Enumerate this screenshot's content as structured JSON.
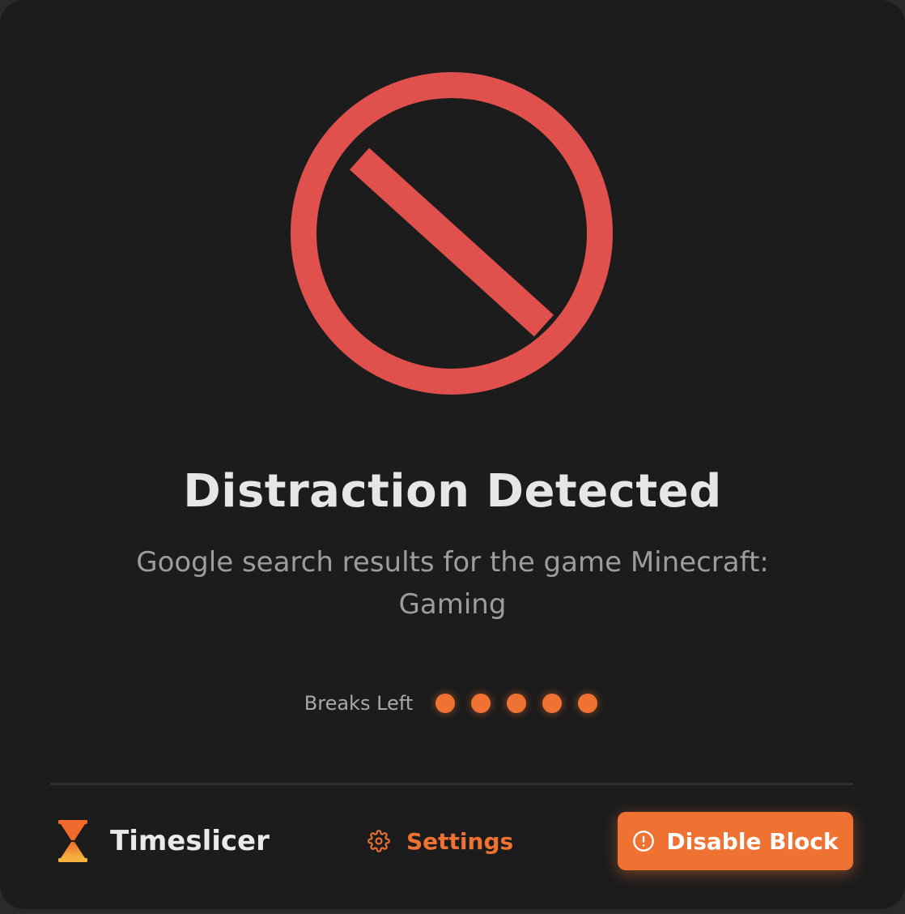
{
  "block": {
    "icon": "prohibited-icon",
    "title": "Distraction Detected",
    "description": "Google search results for the game Minecraft: Gaming"
  },
  "breaks": {
    "label": "Breaks Left",
    "remaining": 5
  },
  "footer": {
    "brand_name": "Timeslicer",
    "brand_icon": "hourglass-icon",
    "settings_label": "Settings",
    "settings_icon": "gear-icon",
    "disable_label": "Disable Block",
    "disable_icon": "alert-circle-icon"
  },
  "colors": {
    "accent": "#f07232",
    "danger": "#e0504d",
    "background": "#1c1c1d"
  }
}
